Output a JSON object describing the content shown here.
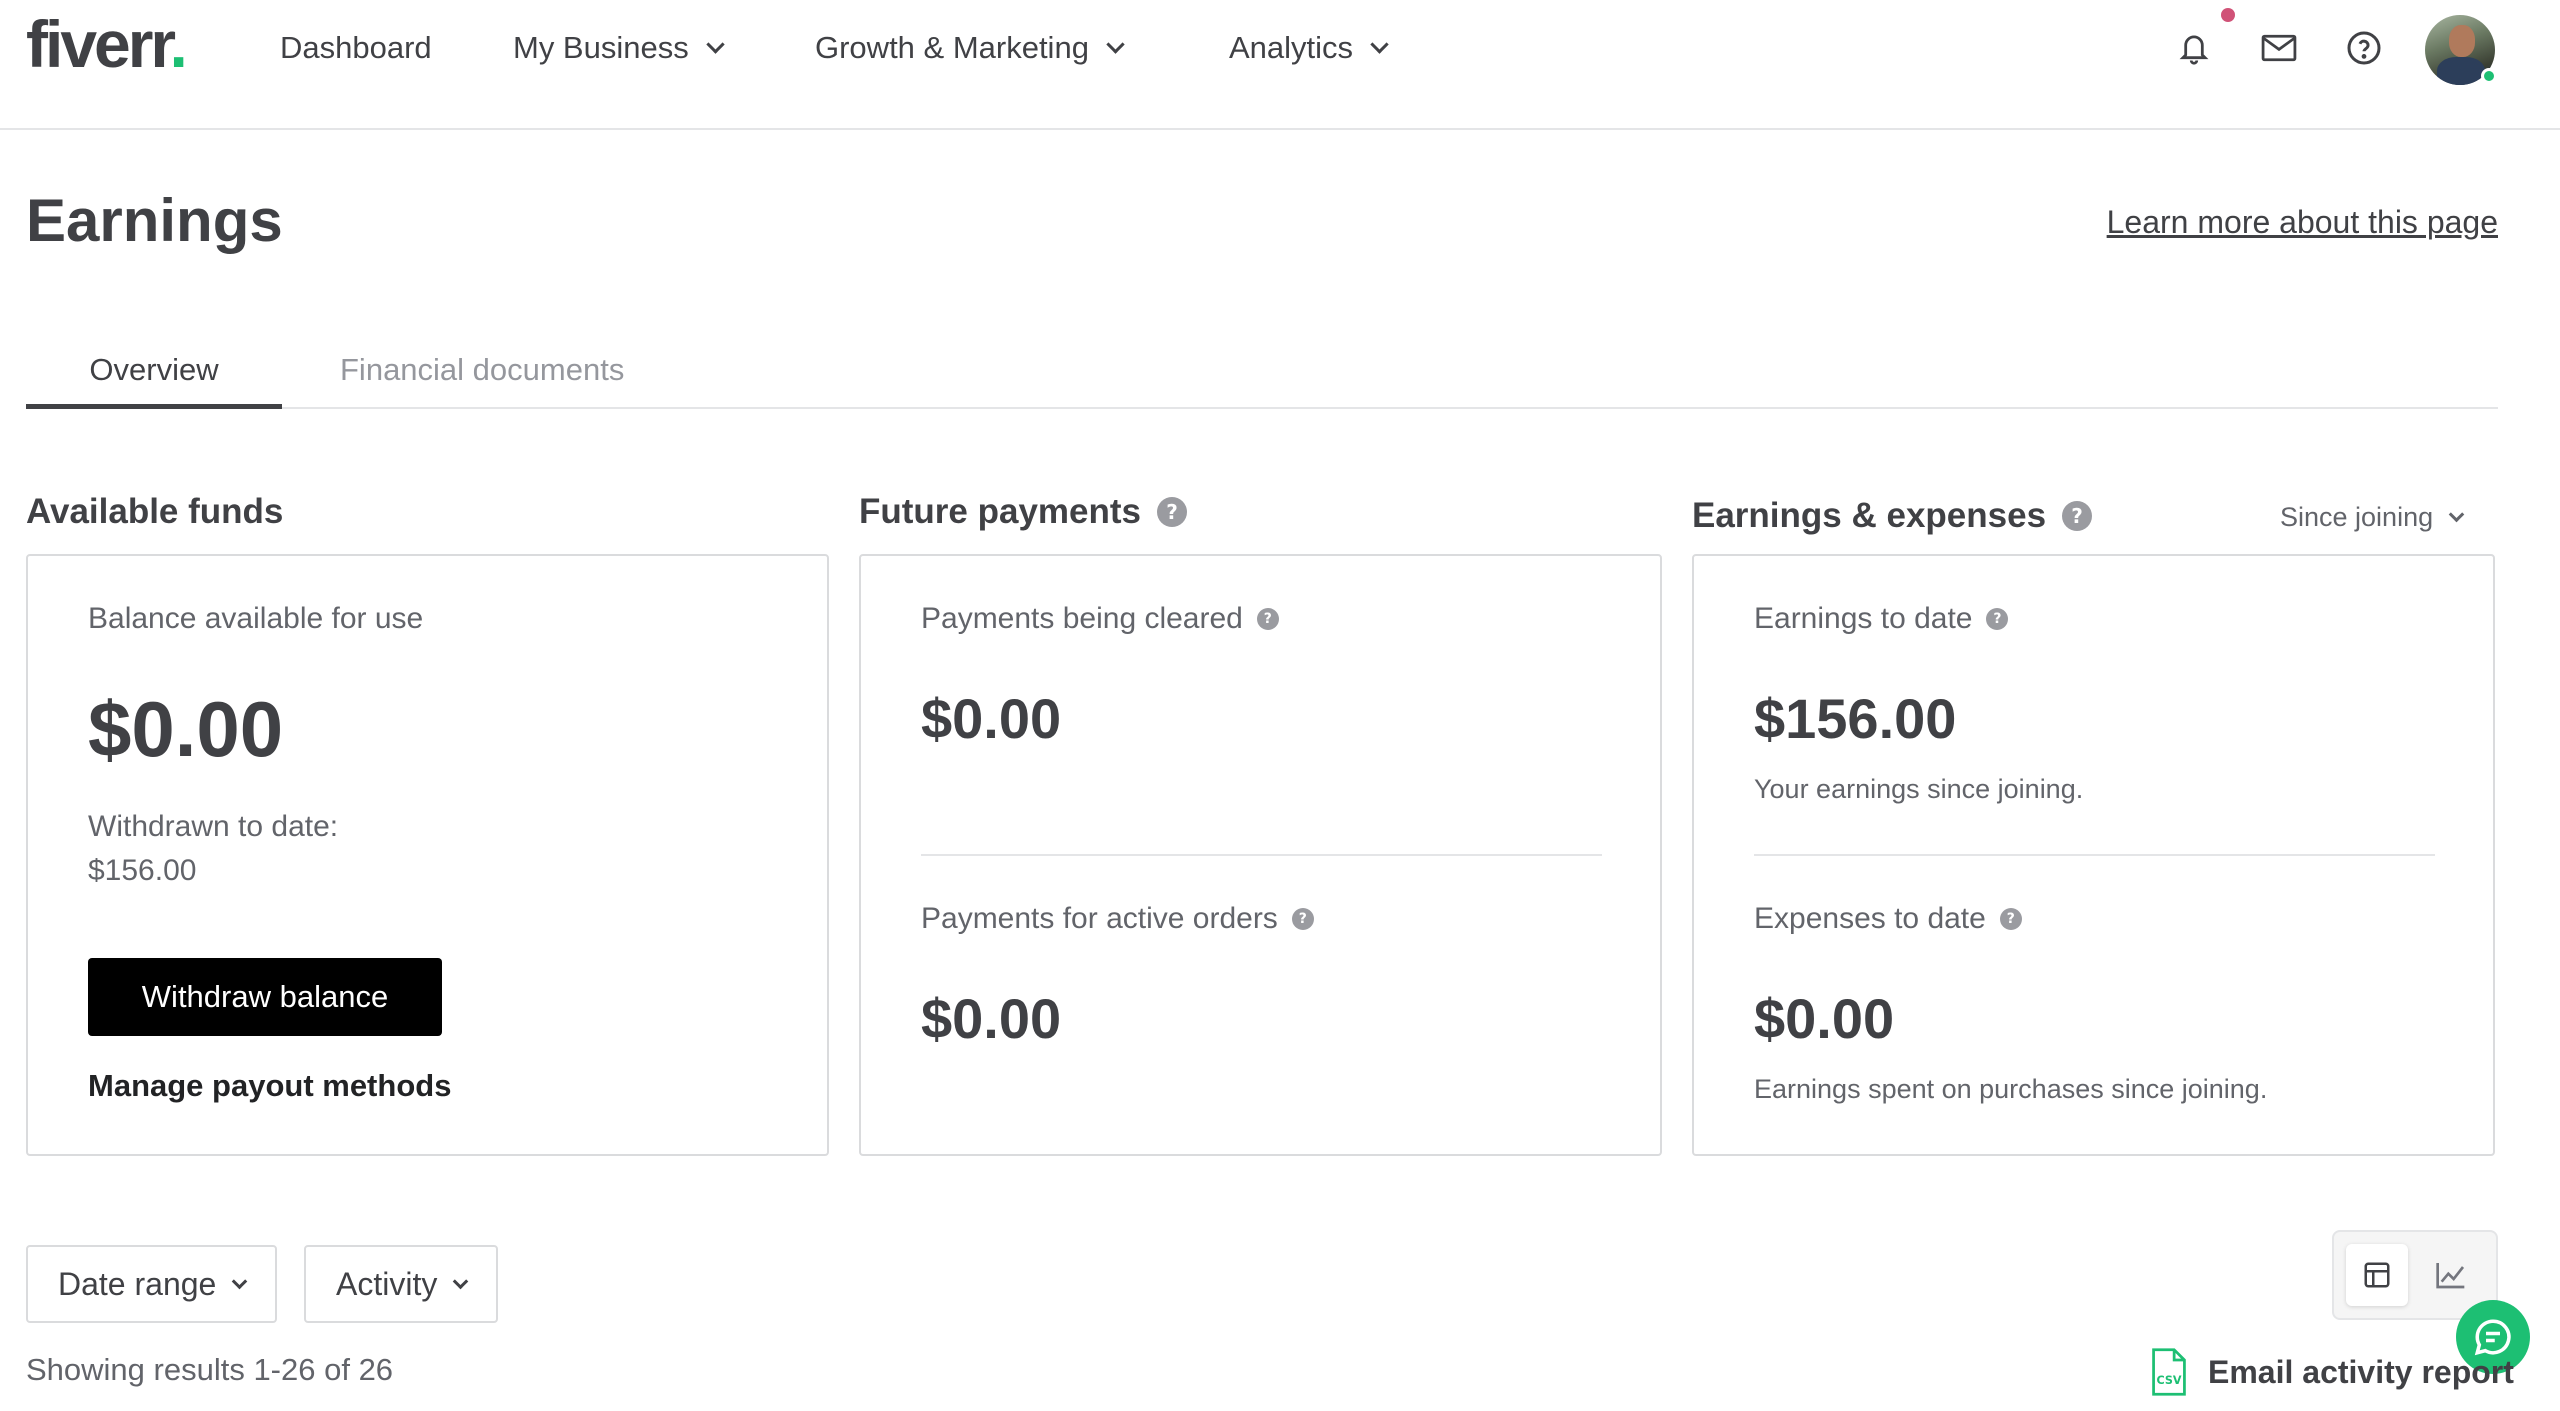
{
  "header": {
    "logo_text": "fiverr",
    "logo_dot": ".",
    "nav": [
      {
        "label": "Dashboard"
      },
      {
        "label": "My Business"
      },
      {
        "label": "Growth & Marketing"
      },
      {
        "label": "Analytics"
      }
    ],
    "icons": [
      "bell-icon",
      "envelope-icon",
      "help-icon"
    ]
  },
  "page": {
    "title": "Earnings",
    "learn_more": "Learn more about this page"
  },
  "tabs": [
    {
      "label": "Overview",
      "active": true
    },
    {
      "label": "Financial documents",
      "active": false
    }
  ],
  "available_funds": {
    "title": "Available funds",
    "balance_label": "Balance available for use",
    "balance": "$0.00",
    "withdrawn_label": "Withdrawn to date:",
    "withdrawn_value": "$156.00",
    "withdraw_button": "Withdraw balance",
    "manage_link": "Manage payout methods"
  },
  "future_payments": {
    "title": "Future payments",
    "clearing_label": "Payments being cleared",
    "clearing_value": "$0.00",
    "active_label": "Payments for active orders",
    "active_value": "$0.00"
  },
  "earnings_expenses": {
    "title": "Earnings & expenses",
    "period": "Since joining",
    "earnings_label": "Earnings to date",
    "earnings_value": "$156.00",
    "earnings_note": "Your earnings since joining.",
    "expenses_label": "Expenses to date",
    "expenses_value": "$0.00",
    "expenses_note": "Earnings spent on purchases since joining."
  },
  "filters": {
    "date_range": "Date range",
    "activity": "Activity"
  },
  "results_text": "Showing results 1-26 of 26",
  "email_report": "Email activity report",
  "csv_icon_text": "CSV",
  "colors": {
    "brand_green": "#1dbf73",
    "text_dark": "#404145",
    "text_muted": "#62646a",
    "notification": "#d05277"
  }
}
